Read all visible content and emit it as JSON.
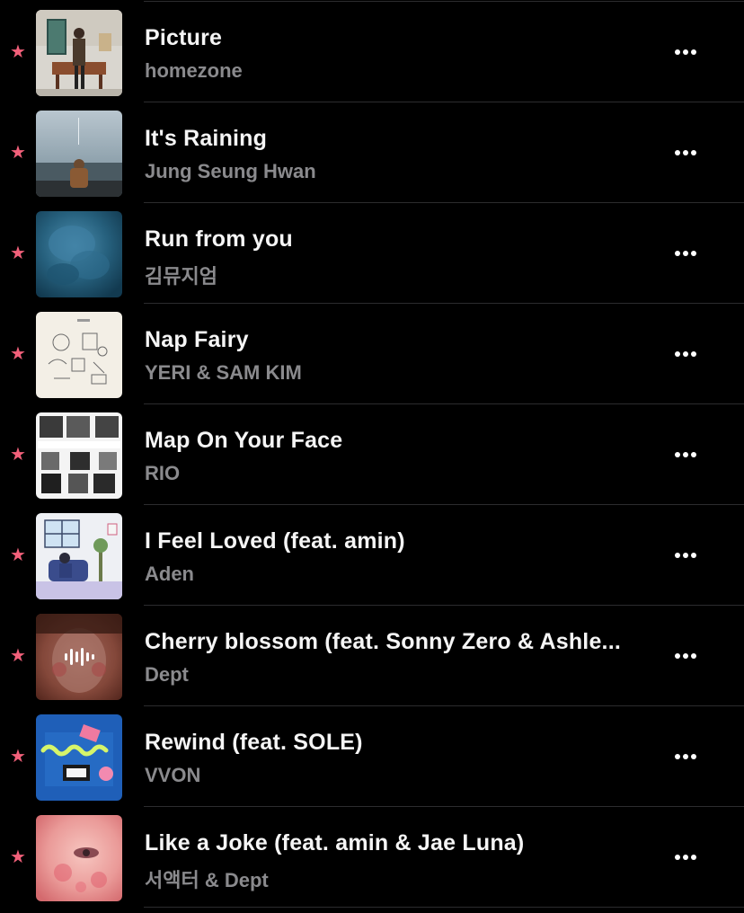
{
  "colors": {
    "background": "#000000",
    "star": "#f2607a",
    "title": "#f5f5f5",
    "artist": "#8a8a8d",
    "divider": "#2c2c2e"
  },
  "tracks": [
    {
      "title": "Picture",
      "artist": "homezone",
      "favorite_icon": "star-icon",
      "more_icon": "ellipsis-icon"
    },
    {
      "title": "It's Raining",
      "artist": "Jung Seung Hwan",
      "favorite_icon": "star-icon",
      "more_icon": "ellipsis-icon"
    },
    {
      "title": "Run from you",
      "artist": "김뮤지엄",
      "favorite_icon": "star-icon",
      "more_icon": "ellipsis-icon"
    },
    {
      "title": "Nap Fairy",
      "artist": "YERI & SAM KIM",
      "favorite_icon": "star-icon",
      "more_icon": "ellipsis-icon"
    },
    {
      "title": "Map On Your Face",
      "artist": "RIO",
      "favorite_icon": "star-icon",
      "more_icon": "ellipsis-icon"
    },
    {
      "title": "I Feel Loved (feat. amin)",
      "artist": "Aden",
      "favorite_icon": "star-icon",
      "more_icon": "ellipsis-icon"
    },
    {
      "title": "Cherry blossom (feat. Sonny Zero & Ashle...",
      "artist": "Dept",
      "favorite_icon": "star-icon",
      "more_icon": "ellipsis-icon",
      "now_playing": true
    },
    {
      "title": "Rewind (feat. SOLE)",
      "artist": "VVON",
      "favorite_icon": "star-icon",
      "more_icon": "ellipsis-icon"
    },
    {
      "title": "Like a Joke (feat. amin & Jae Luna)",
      "artist": "서액터 & Dept",
      "favorite_icon": "star-icon",
      "more_icon": "ellipsis-icon"
    }
  ]
}
